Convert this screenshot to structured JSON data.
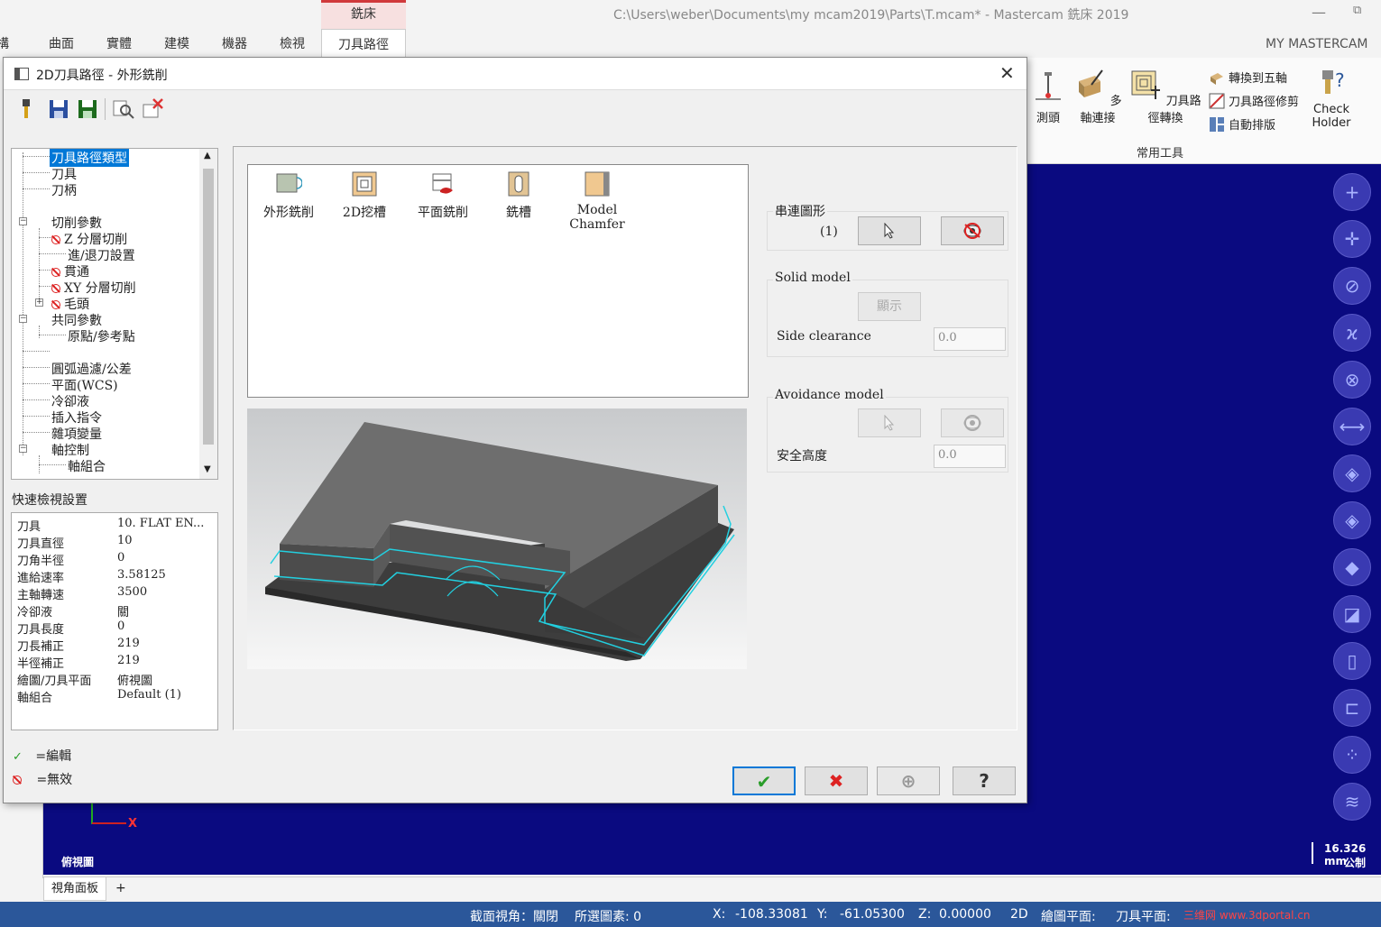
{
  "app": {
    "context_tab": "銑床",
    "window_title": "C:\\Users\\weber\\Documents\\my mcam2019\\Parts\\T.mcam* - Mastercam 銑床 2019",
    "my_mastercam": "MY MASTERCAM",
    "tabs": [
      "構",
      "曲面",
      "實體",
      "建模",
      "機器",
      "檢視",
      "刀具路徑"
    ],
    "active_tab": "刀具路徑"
  },
  "ribbon": {
    "probe": "測頭",
    "multiaxis_link": "多軸連接",
    "toolpath_transform": "刀具路徑轉換",
    "convert_5axis": "轉換到五軸",
    "trim_toolpath": "刀具路徑修剪",
    "auto_nest": "自動排版",
    "check_holder_1": "Check",
    "check_holder_2": "Holder",
    "group_label": "常用工具"
  },
  "dialog": {
    "title": "2D刀具路徑 - 外形銑削",
    "tree": {
      "items": [
        "刀具路徑類型",
        "刀具",
        "刀柄",
        "切削參數",
        "Z 分層切削",
        "進/退刀設置",
        "貫通",
        "XY 分層切削",
        "毛頭",
        "共同參數",
        "原點/參考點",
        "",
        "圓弧過濾/公差",
        "平面(WCS)",
        "冷卻液",
        "插入指令",
        "雜項變量",
        "軸控制",
        "軸組合"
      ]
    },
    "quick_view": {
      "label": "快速檢視設置",
      "rows": [
        {
          "k": "刀具",
          "v": "10. FLAT EN..."
        },
        {
          "k": "刀具直徑",
          "v": "10"
        },
        {
          "k": "刀角半徑",
          "v": "0"
        },
        {
          "k": "進給速率",
          "v": "3.58125"
        },
        {
          "k": "主軸轉速",
          "v": "3500"
        },
        {
          "k": "冷卻液",
          "v": "關"
        },
        {
          "k": "刀具長度",
          "v": "0"
        },
        {
          "k": "刀長補正",
          "v": "219"
        },
        {
          "k": "半徑補正",
          "v": "219"
        },
        {
          "k": "繪圖/刀具平面",
          "v": "俯視圖"
        },
        {
          "k": "軸組合",
          "v": "Default (1)"
        }
      ]
    },
    "legend": {
      "edited": "=編輯",
      "invalid": "=無效"
    },
    "toolpath_types": [
      "外形銑削",
      "2D挖槽",
      "平面銑削",
      "銑槽",
      "Model\nChamfer"
    ],
    "chain": {
      "label": "串連圖形",
      "count": "(1)"
    },
    "solid_model": {
      "label": "Solid model",
      "show_button": "顯示",
      "side_clearance_label": "Side clearance",
      "side_clearance_value": "0.0"
    },
    "avoidance": {
      "label": "Avoidance model",
      "safe_height_label": "安全高度",
      "safe_height_value": "0.0"
    }
  },
  "viewport": {
    "axis_x": "X",
    "view_name": "俯視圖",
    "scale_value": "16.326 mm",
    "scale_unit": "公制",
    "view_tab": "視角面板",
    "view_tab_add": "+"
  },
  "status": {
    "section_view": "截面視角：關閉",
    "selected": "所選圖素: 0",
    "x_label": "X:",
    "x_value": "-108.33081",
    "y_label": "Y:",
    "y_value": "-61.05300",
    "z_label": "Z:",
    "z_value": "0.00000",
    "mode": "2D",
    "cplane": "繪圖平面:",
    "tplane": "刀具平面:",
    "watermark": "三维网 www.3dportal.cn"
  },
  "colors": {
    "viewport_bg": "#0a0a80",
    "statusbar": "#2b579a",
    "selection": "#0078d7",
    "context_accent": "#d0393b"
  }
}
